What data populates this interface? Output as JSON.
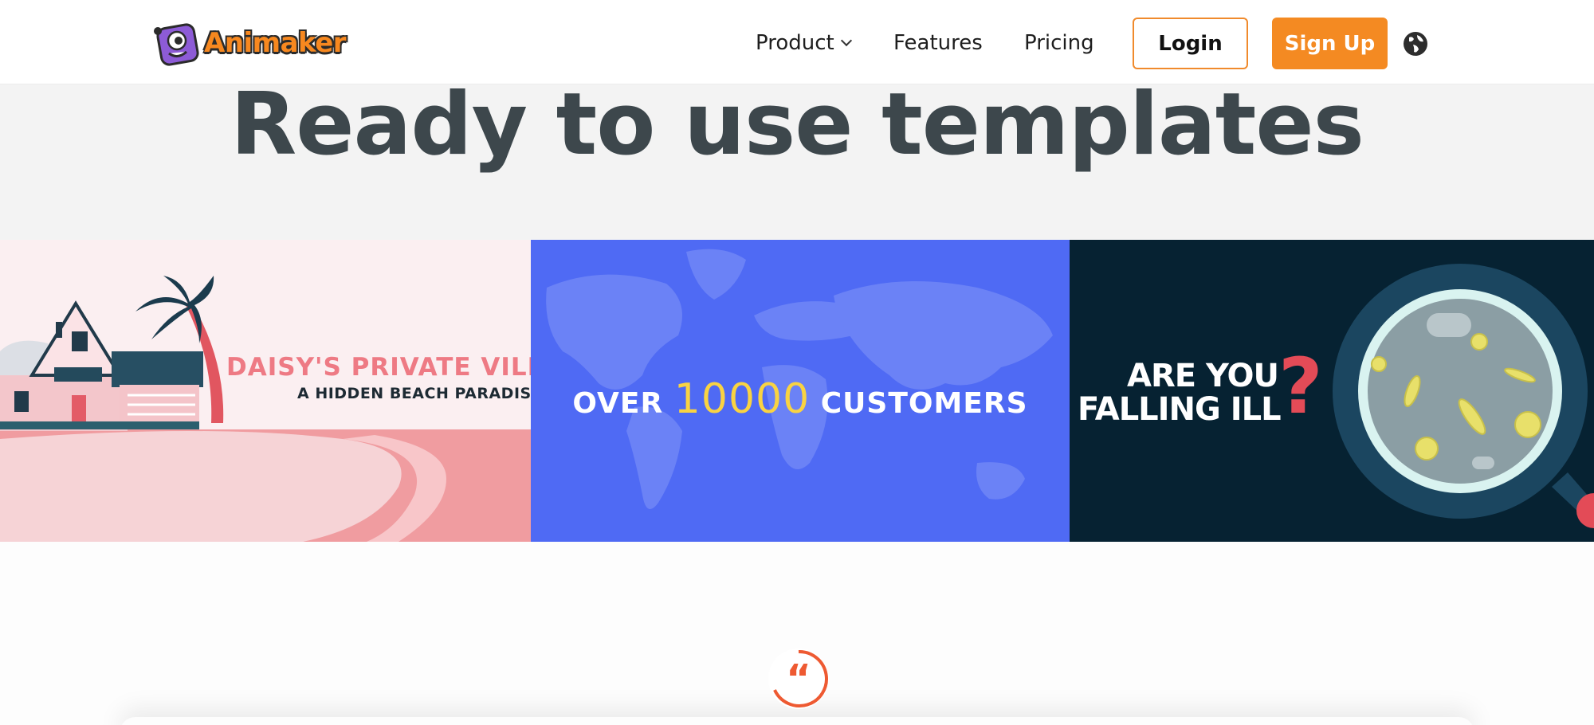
{
  "header": {
    "brand": "Animaker",
    "nav": {
      "product": "Product",
      "features": "Features",
      "pricing": "Pricing"
    },
    "login": "Login",
    "signup": "Sign Up",
    "language_icon": "globe-icon"
  },
  "hero": {
    "headline": "Ready to use templates"
  },
  "templates": [
    {
      "title": "DAISY'S PRIVATE VILLA",
      "subtitle": "A HIDDEN BEACH PARADISE"
    },
    {
      "prefix": "OVER",
      "number": "10000",
      "suffix": "CUSTOMERS"
    },
    {
      "line1": "ARE YOU",
      "line2": "FALLING ILL",
      "mark": "?"
    }
  ],
  "testimonial": {
    "quote_icon": "quote-icon",
    "quote_mark": "“"
  },
  "colors": {
    "brand_orange": "#f48a22",
    "headline": "#3d474c",
    "tile2_bg": "#4f6af4",
    "tile3_bg": "#062232"
  }
}
